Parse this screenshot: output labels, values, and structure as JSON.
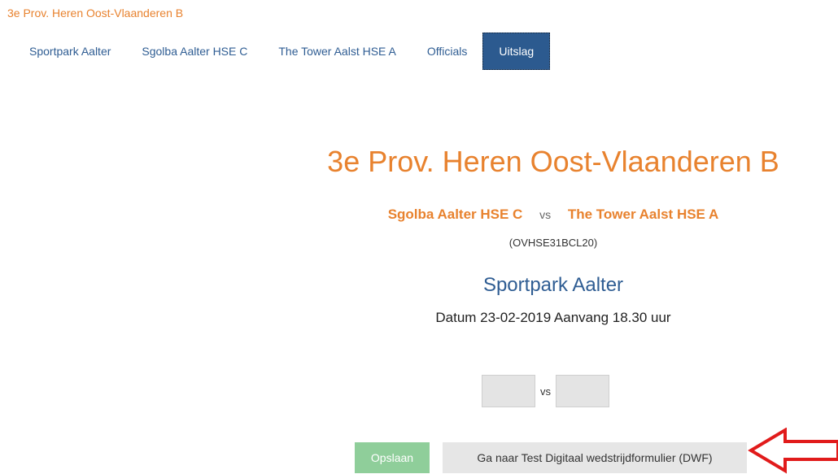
{
  "breadcrumb": "3e Prov. Heren Oost-Vlaanderen B",
  "tabs": [
    {
      "label": "Sportpark Aalter"
    },
    {
      "label": "Sgolba Aalter HSE C"
    },
    {
      "label": "The Tower Aalst HSE A"
    },
    {
      "label": "Officials"
    },
    {
      "label": "Uitslag",
      "active": true
    }
  ],
  "match": {
    "title": "3e Prov. Heren Oost-Vlaanderen B",
    "home_team": "Sgolba Aalter HSE C",
    "vs": "vs",
    "away_team": "The Tower Aalst HSE A",
    "code": "(OVHSE31BCL20)",
    "venue": "Sportpark Aalter",
    "datetime": "Datum 23-02-2019 Aanvang 18.30 uur"
  },
  "score": {
    "home_value": "",
    "vs": "vs",
    "away_value": ""
  },
  "buttons": {
    "save": "Opslaan",
    "dwf": "Ga naar Test Digitaal wedstrijdformulier (DWF)"
  },
  "annotation": {
    "arrow_color": "#e11b1b",
    "arrow_direction": "left"
  },
  "colors": {
    "accent_orange": "#e8822e",
    "link_blue": "#2f5d93",
    "active_tab": "#2c5a8f",
    "save_green": "#8fce9a"
  }
}
